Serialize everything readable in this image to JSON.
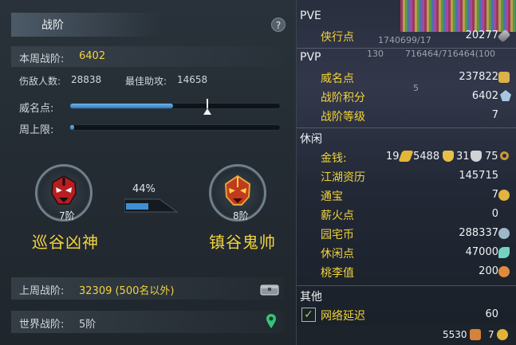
{
  "left": {
    "title": "战阶",
    "help_label": "?",
    "weekly_label": "本周战阶:",
    "weekly_value": "6402",
    "defeated_label": "伤敌人数:",
    "defeated_value": "28838",
    "assist_label": "最佳助攻:",
    "assist_value": "14658",
    "prestige_label": "威名点:",
    "prestige_fill": 0.49,
    "prestige_marker": 0.65,
    "weekly_cap_label": "周上限:",
    "weekly_cap_fill": 0.015,
    "progress_pct": "44%",
    "progress_fill": 0.44,
    "rank_left": {
      "num": "7阶",
      "name": "巡谷凶神"
    },
    "rank_right": {
      "num": "8阶",
      "name": "镇谷鬼帅"
    },
    "last_week_label": "上周战阶:",
    "last_week_value": "32309 (500名以外)",
    "world_label": "世界战阶:",
    "world_value": "5阶"
  },
  "right": {
    "pve": {
      "header": "PVE",
      "items": [
        {
          "label": "侠行点",
          "value": "20277"
        }
      ]
    },
    "pvp": {
      "header": "PVP",
      "items": [
        {
          "label": "威名点",
          "value": "237822"
        },
        {
          "label": "战阶积分",
          "value": "6402"
        },
        {
          "label": "战阶等级",
          "value": "7"
        }
      ]
    },
    "leisure": {
      "header": "休闲",
      "money_label": "金钱:",
      "money": {
        "gold_bar": "19",
        "gold": "5488",
        "silver": "31",
        "copper": "75"
      },
      "items": [
        {
          "label": "江湖资历",
          "value": "145715"
        },
        {
          "label": "通宝",
          "value": "7"
        },
        {
          "label": "薪火点",
          "value": "0"
        },
        {
          "label": "园宅币",
          "value": "288337"
        },
        {
          "label": "休闲点",
          "value": "47000"
        },
        {
          "label": "桃李值",
          "value": "200"
        }
      ]
    },
    "other": {
      "header": "其他",
      "latency_label": "网络延迟",
      "latency_value": "60"
    },
    "footer": {
      "left_value": "5530",
      "right_value": "7"
    },
    "overlay_numbers": [
      "130",
      "1740699/17",
      "716464/716464(100",
      "5"
    ]
  },
  "colors": {
    "accent_yellow": "#f1d33c",
    "bar_blue": "#3f8fd4"
  }
}
